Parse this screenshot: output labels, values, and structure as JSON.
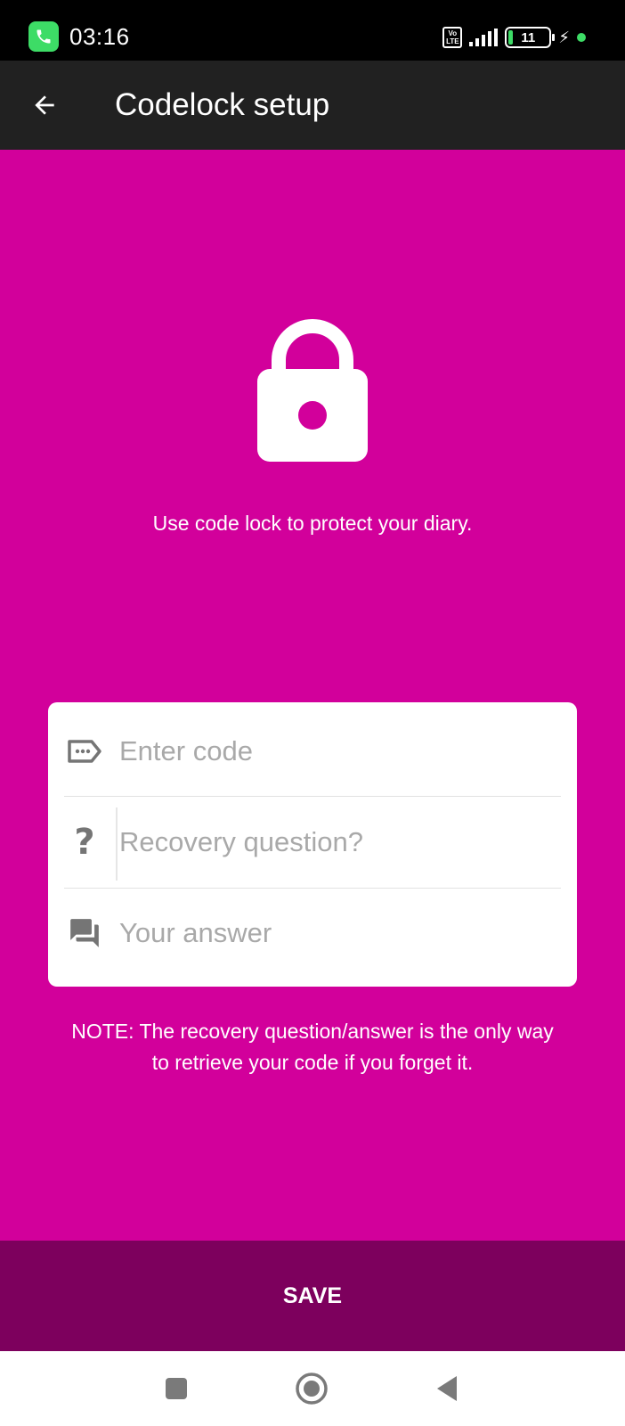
{
  "status_bar": {
    "time": "03:16",
    "volte_line1": "Vo",
    "volte_line2": "LTE",
    "battery_level": "11",
    "icons": [
      "phone-call-icon",
      "volte-icon",
      "signal-icon",
      "battery-icon",
      "charging-bolt-icon",
      "green-dot-indicator"
    ]
  },
  "app_bar": {
    "title": "Codelock setup",
    "back_icon": "arrow-left-icon"
  },
  "hero": {
    "icon": "lock-icon",
    "tagline": "Use code lock to protect your diary."
  },
  "form": {
    "code_placeholder": "Enter code",
    "code_value": "",
    "question_placeholder": "Recovery question?",
    "question_value": "",
    "answer_placeholder": "Your answer",
    "answer_value": "",
    "icons": [
      "password-tag-icon",
      "question-mark-icon",
      "chat-bubbles-icon"
    ]
  },
  "note": {
    "line1": "NOTE: The recovery question/answer is the only way",
    "line2": "to retrieve your code if you forget it."
  },
  "save_label": "SAVE",
  "nav": {
    "icons": [
      "square-recents-icon",
      "circle-home-icon",
      "triangle-back-icon"
    ]
  },
  "colors": {
    "primary": "#d2009b",
    "primary_dark": "#7d005d",
    "app_bar": "#212121",
    "status_bar": "#000000",
    "accent_green": "#3ddc66"
  }
}
